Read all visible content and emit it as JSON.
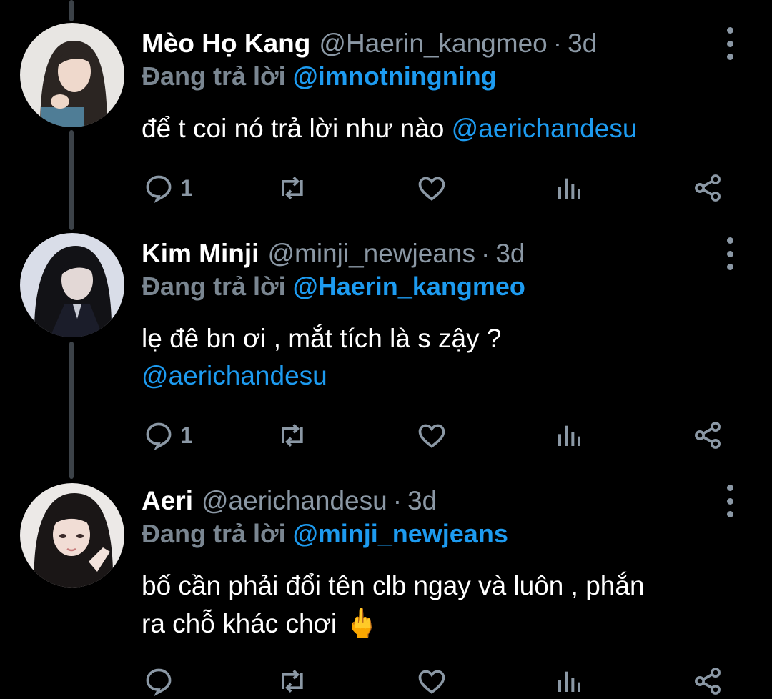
{
  "tweets": [
    {
      "name": "Mèo Họ Kang",
      "handle": "@Haerin_kangmeo",
      "time": "3d",
      "replying_label": "Đang trả lời",
      "replying_to": "@imnotningning",
      "text": "để t coi nó trả lời như nào ",
      "mention": "@aerichandesu",
      "reply_count": "1"
    },
    {
      "name": "Kim Minji",
      "handle": "@minji_newjeans",
      "time": "3d",
      "replying_label": "Đang trả lời",
      "replying_to": "@Haerin_kangmeo",
      "text_line1": "lẹ đê bn ơi , mắt tích là s zậy ?",
      "mention": "@aerichandesu",
      "reply_count": "1"
    },
    {
      "name": "Aeri",
      "handle": "@aerichandesu",
      "time": "3d",
      "replying_label": "Đang trả lời",
      "replying_to": "@minji_newjeans",
      "text_line1": "bố cần phải đổi tên clb ngay và luôn , phắn",
      "text_line2": "ra chỗ khác chơi ",
      "emoji": "🖕"
    }
  ],
  "separator": "·",
  "icons": [
    "reply-icon",
    "retweet-icon",
    "like-icon",
    "views-icon",
    "share-icon",
    "more-icon"
  ],
  "colors": {
    "background": "#000000",
    "accent": "#1d9bf0",
    "muted": "#8b98a5",
    "thread_line": "#3c4248"
  }
}
